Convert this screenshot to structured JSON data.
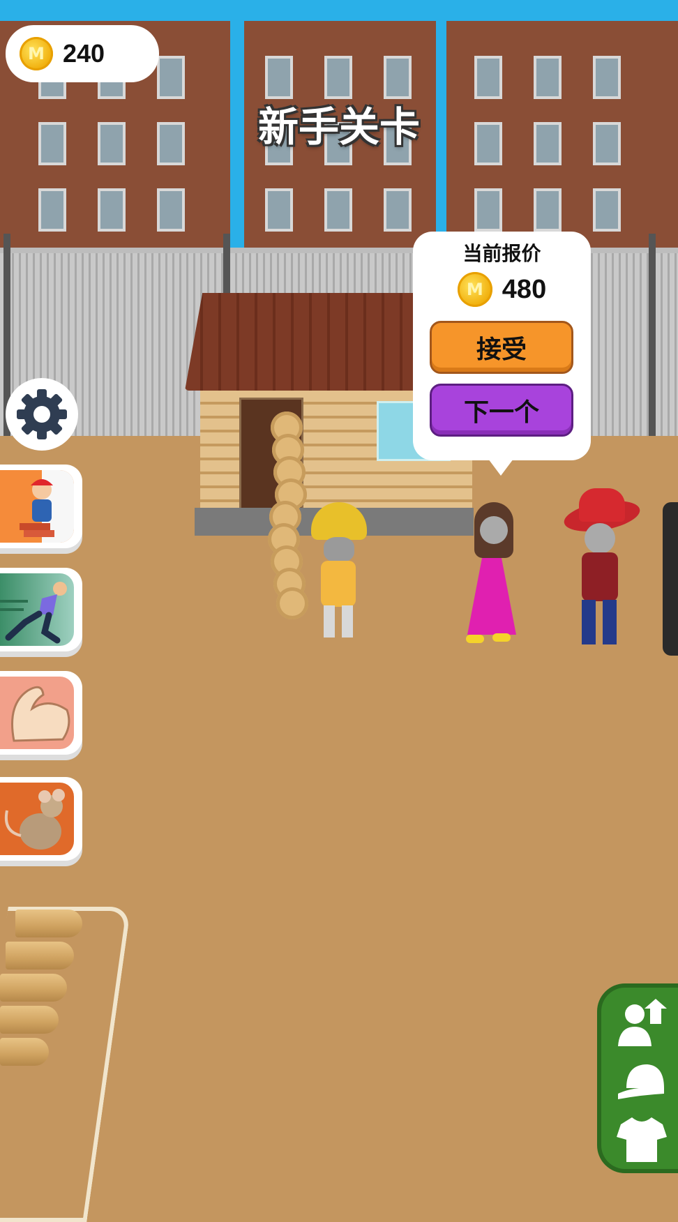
{
  "hud": {
    "coin_symbol": "M",
    "coin_balance": "240",
    "level_title": "新手关卡"
  },
  "offer": {
    "title": "当前报价",
    "coin_symbol": "M",
    "price": "480",
    "accept_label": "接受",
    "next_label": "下一个"
  },
  "icons": {
    "settings": "gear-icon",
    "skills": [
      "bricklayer-icon",
      "runner-icon",
      "muscle-arm-icon",
      "mouse-icon"
    ],
    "right_panel": [
      "character-upgrade-icon",
      "cap-icon",
      "shirt-icon"
    ]
  },
  "colors": {
    "accept_button": "#f6952a",
    "next_button": "#a843dc",
    "right_panel": "#3b8a2b",
    "ground": "#c4965f"
  }
}
